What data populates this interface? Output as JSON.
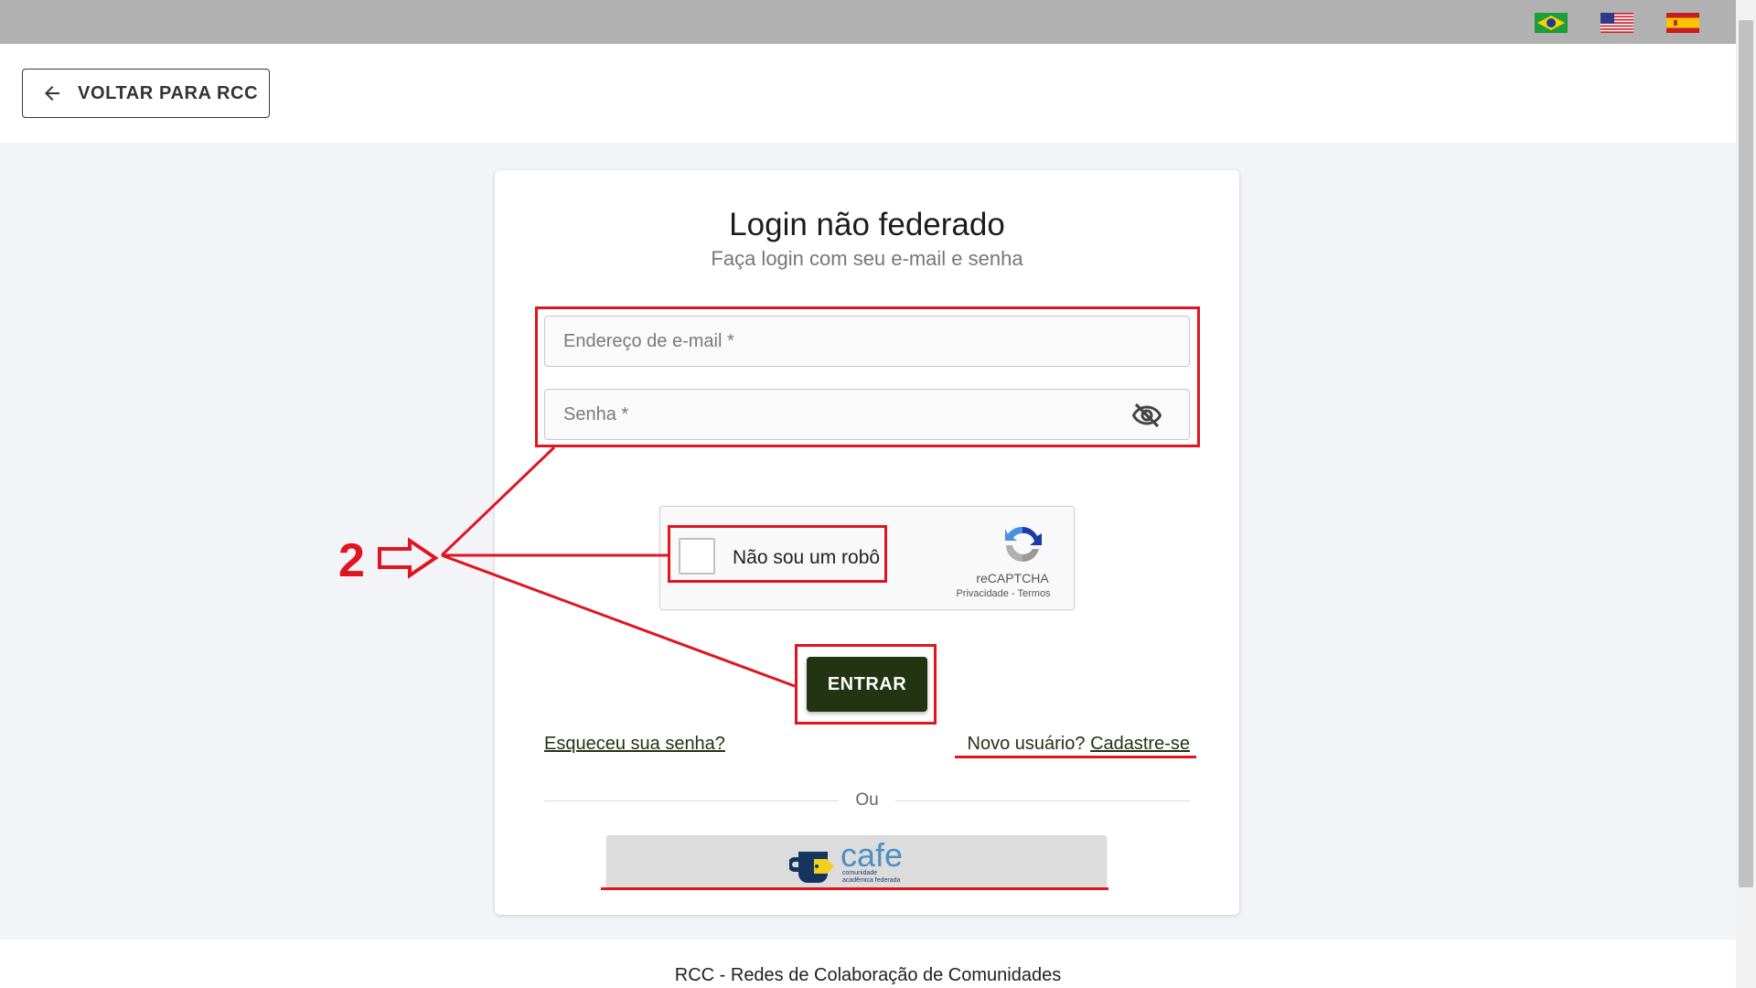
{
  "languages": [
    {
      "name": "flag-brazil-icon"
    },
    {
      "name": "flag-usa-icon"
    },
    {
      "name": "flag-spain-icon"
    }
  ],
  "header": {
    "back_label": "VOLTAR PARA RCC"
  },
  "login": {
    "title": "Login não federado",
    "subtitle": "Faça login com seu e-mail e senha",
    "email_placeholder": "Endereço de e-mail *",
    "password_placeholder": "Senha *",
    "captcha": {
      "label": "Não sou um robô",
      "brand": "reCAPTCHA",
      "privacy": "Privacidade",
      "separator": " - ",
      "terms": "Termos"
    },
    "submit_label": "ENTRAR",
    "forgot_label": "Esqueceu sua senha?",
    "new_user_prefix": "Novo usuário? ",
    "register_label": "Cadastre-se",
    "divider_label": "Ou",
    "cafe": {
      "word": "cafe",
      "tagline_1": "comunidade",
      "tagline_2": "acadêmica federada"
    }
  },
  "footer": {
    "text": "RCC - Redes de Colaboração de Comunidades"
  },
  "annotation": {
    "step_number": "2"
  },
  "colors": {
    "primary_button": "#233412",
    "annotation": "#e0151f",
    "topbar": "#b1b1b1"
  }
}
